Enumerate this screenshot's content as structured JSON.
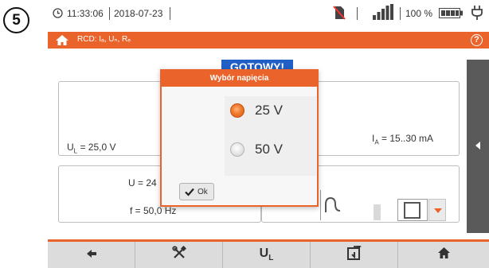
{
  "step_number": "5",
  "status": {
    "time": "11:33:06",
    "date": "2018-07-23",
    "battery_percent": "100 %",
    "signal_level": 1.0,
    "battery_level": 1.0
  },
  "header": {
    "title": "RCD: Iₐ, Uₙ, Rₑ",
    "help_label": "?"
  },
  "screen": {
    "status_label": "GOTOWY!",
    "ul_value": "U",
    "ul_sub": "L",
    "ul_rest": " = 25,0 V",
    "ia_value": "I",
    "ia_sub": "A",
    "ia_rest": " = 15..30 mA",
    "u_value": "U = 24",
    "f_value": "f = 50,0 Hz"
  },
  "dialog": {
    "title": "Wybór napięcia",
    "options": [
      {
        "label": "25 V",
        "selected": true
      },
      {
        "label": "50 V",
        "selected": false
      }
    ],
    "ok_label": "Ok"
  },
  "toolbar": {
    "items": [
      {
        "icon": "back-arrow-icon"
      },
      {
        "icon": "settings-tools-icon"
      },
      {
        "icon": "ul-icon",
        "label": "U",
        "sub": "L"
      },
      {
        "icon": "save-memory-icon"
      },
      {
        "icon": "home-icon"
      }
    ]
  },
  "colors": {
    "accent": "#e9632a",
    "status_blue": "#1f5fc6"
  }
}
